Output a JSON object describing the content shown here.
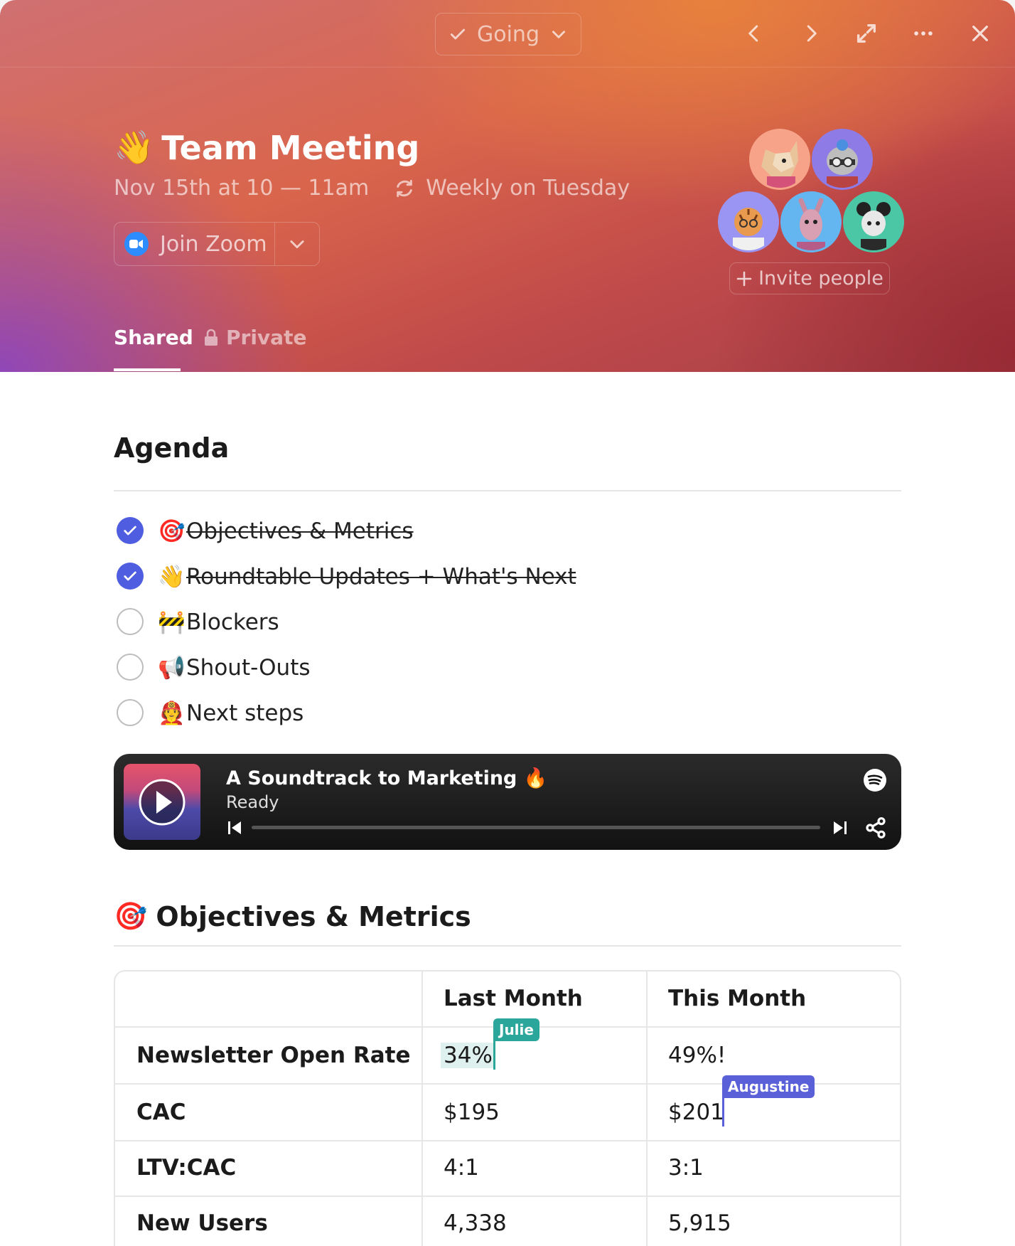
{
  "header": {
    "rsvp_label": "Going",
    "title_emoji": "👋",
    "title": "Team Meeting",
    "time": "Nov 15th at 10 — 11am",
    "recurrence": "Weekly on Tuesday",
    "zoom_label": "Join Zoom",
    "invite_label": "Invite people",
    "tabs": [
      {
        "label": "Shared",
        "active": true
      },
      {
        "label": "Private",
        "active": false
      }
    ],
    "icons": [
      "check-icon",
      "chevron-down-icon",
      "chevron-left-icon",
      "chevron-right-icon",
      "expand-icon",
      "more-icon",
      "close-icon",
      "repeat-icon",
      "zoom-icon",
      "plus-icon",
      "lock-icon"
    ]
  },
  "attendees": [
    {
      "name": "fox-avatar",
      "color": "#f6a38a"
    },
    {
      "name": "raccoon-avatar",
      "color": "#8f7be6"
    },
    {
      "name": "tiger-avatar",
      "color": "#9a95f2"
    },
    {
      "name": "donkey-avatar",
      "color": "#63b6ef"
    },
    {
      "name": "mouse-avatar",
      "color": "#4cc7a6"
    }
  ],
  "agenda": {
    "heading": "Agenda",
    "items": [
      {
        "emoji": "🎯",
        "text": "Objectives & Metrics",
        "done": true
      },
      {
        "emoji": "👋",
        "text": "Roundtable Updates + What's Next",
        "done": true
      },
      {
        "emoji": "🚧",
        "text": "Blockers",
        "done": false
      },
      {
        "emoji": "📢",
        "text": "Shout-Outs",
        "done": false
      },
      {
        "emoji": "🧑‍🚒",
        "text": "Next steps",
        "done": false
      }
    ]
  },
  "player": {
    "title": "A Soundtrack to Marketing 🔥",
    "status": "Ready",
    "progress": 0
  },
  "metrics": {
    "heading_emoji": "🎯",
    "heading": "Objectives & Metrics",
    "columns": [
      "",
      "Last Month",
      "This Month"
    ],
    "rows": [
      {
        "label": "Newsletter Open Rate",
        "last": "34%",
        "this": "49%!"
      },
      {
        "label": "CAC",
        "last": "$195",
        "this": "$201"
      },
      {
        "label": "LTV:CAC",
        "last": "4:1",
        "this": "3:1"
      },
      {
        "label": "New Users",
        "last": "4,338",
        "this": "5,915"
      }
    ],
    "collaborators": [
      {
        "name": "Julie",
        "color": "#2aa69a"
      },
      {
        "name": "Augustine",
        "color": "#5a60d8"
      }
    ]
  },
  "colors": {
    "accent": "#4f5de0"
  }
}
